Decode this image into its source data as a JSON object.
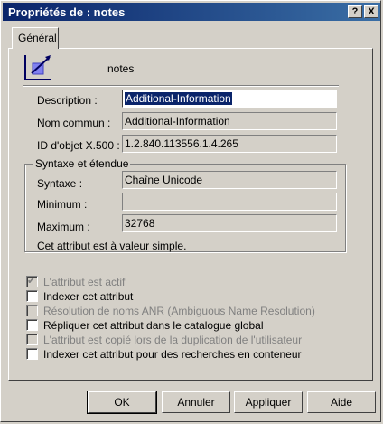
{
  "window": {
    "title": "Propriétés de : notes"
  },
  "titlebar_buttons": {
    "help": "?",
    "close": "X"
  },
  "tabs": [
    {
      "label": "Général"
    }
  ],
  "header": {
    "name": "notes"
  },
  "fields": {
    "description": {
      "label": "Description :",
      "value": "Additional-Information"
    },
    "common_name": {
      "label": "Nom commun :",
      "value": "Additional-Information"
    },
    "object_id": {
      "label": "ID d'objet X.500 :",
      "value": "1.2.840.113556.1.4.265"
    }
  },
  "syntax_group": {
    "title": "Syntaxe et étendue",
    "syntax": {
      "label": "Syntaxe :",
      "value": "Chaîne Unicode"
    },
    "minimum": {
      "label": "Minimum :",
      "value": ""
    },
    "maximum": {
      "label": "Maximum :",
      "value": "32768"
    },
    "note": "Cet attribut est à valeur simple."
  },
  "checkboxes": [
    {
      "label": "L'attribut est actif",
      "checked": true,
      "enabled": false
    },
    {
      "label": "Indexer cet attribut",
      "checked": false,
      "enabled": true
    },
    {
      "label": "Résolution de noms ANR (Ambiguous Name Resolution)",
      "checked": false,
      "enabled": false
    },
    {
      "label": "Répliquer cet attribut dans le catalogue global",
      "checked": false,
      "enabled": true
    },
    {
      "label": "L'attribut est copié lors de la duplication de l'utilisateur",
      "checked": false,
      "enabled": false
    },
    {
      "label": "Indexer cet attribut pour des recherches en conteneur",
      "checked": false,
      "enabled": true
    }
  ],
  "buttons": {
    "ok": "OK",
    "cancel": "Annuler",
    "apply": "Appliquer",
    "help": "Aide"
  },
  "colors": {
    "titlebar": "#0a246a",
    "selection": "#0a246a",
    "face": "#d4d0c8",
    "icon": "#4a4ae0"
  },
  "icon": "attribute-icon"
}
